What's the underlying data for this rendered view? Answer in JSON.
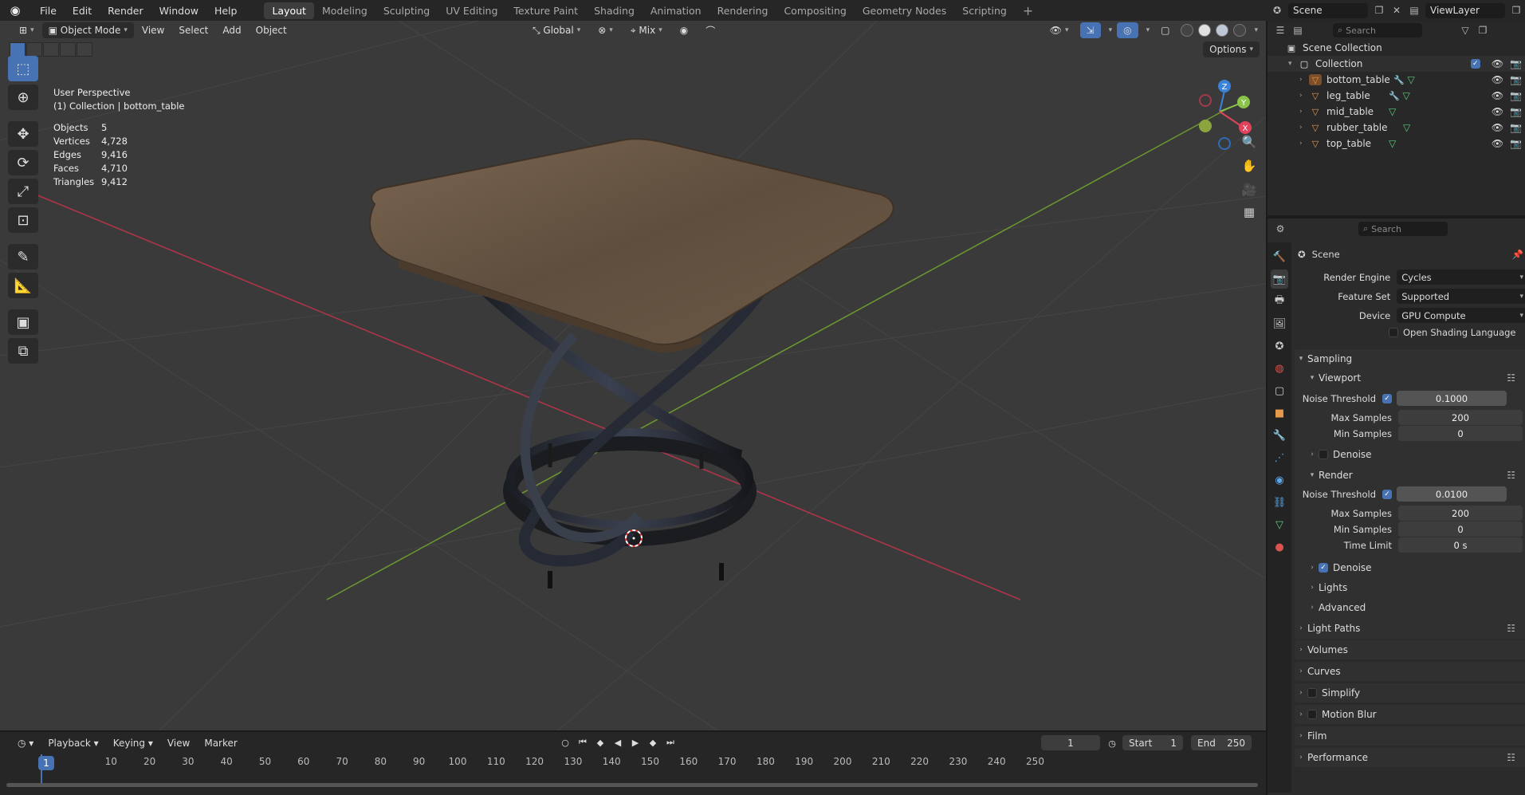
{
  "menubar": {
    "items": [
      "File",
      "Edit",
      "Render",
      "Window",
      "Help"
    ],
    "workspaces": [
      "Layout",
      "Modeling",
      "Sculpting",
      "UV Editing",
      "Texture Paint",
      "Shading",
      "Animation",
      "Rendering",
      "Compositing",
      "Geometry Nodes",
      "Scripting"
    ],
    "active_workspace": "Layout"
  },
  "topright": {
    "scene": "Scene",
    "view_layer": "ViewLayer"
  },
  "viewport": {
    "mode": "Object Mode",
    "menus": [
      "View",
      "Select",
      "Add",
      "Object"
    ],
    "orientation": "Global",
    "proportional": "Mix",
    "options": "Options",
    "overlay": {
      "perspective": "User Perspective",
      "collection": "(1) Collection | bottom_table"
    },
    "stats": [
      {
        "label": "Objects",
        "value": "5"
      },
      {
        "label": "Vertices",
        "value": "4,728"
      },
      {
        "label": "Edges",
        "value": "9,416"
      },
      {
        "label": "Faces",
        "value": "4,710"
      },
      {
        "label": "Triangles",
        "value": "9,412"
      }
    ],
    "gizmo_axes": [
      "X",
      "Y",
      "Z"
    ]
  },
  "timeline": {
    "menus": [
      "Playback",
      "Keying",
      "View",
      "Marker"
    ],
    "current_frame": "1",
    "start_label": "Start",
    "start": "1",
    "end_label": "End",
    "end": "250",
    "ticks": [
      "1",
      "10",
      "20",
      "30",
      "40",
      "50",
      "60",
      "70",
      "80",
      "90",
      "100",
      "110",
      "120",
      "130",
      "140",
      "150",
      "160",
      "170",
      "180",
      "190",
      "200",
      "210",
      "220",
      "230",
      "240",
      "250"
    ]
  },
  "outliner": {
    "search_placeholder": "Search",
    "scene_collection": "Scene Collection",
    "collection": "Collection",
    "objects": [
      "bottom_table",
      "leg_table",
      "mid_table",
      "rubber_table",
      "top_table"
    ]
  },
  "properties": {
    "search_placeholder": "Search",
    "context": "Scene",
    "render_engine_label": "Render Engine",
    "render_engine": "Cycles",
    "feature_set_label": "Feature Set",
    "feature_set": "Supported",
    "device_label": "Device",
    "device": "GPU Compute",
    "osl": "Open Shading Language",
    "sampling": "Sampling",
    "viewport": "Viewport",
    "render": "Render",
    "noise_threshold_label": "Noise Threshold",
    "viewport_noise": "0.1000",
    "render_noise": "0.0100",
    "max_samples_label": "Max Samples",
    "viewport_max": "200",
    "render_max": "200",
    "min_samples_label": "Min Samples",
    "viewport_min": "0",
    "render_min": "0",
    "time_limit_label": "Time Limit",
    "time_limit": "0 s",
    "denoise": "Denoise",
    "lights": "Lights",
    "advanced": "Advanced",
    "panels": [
      "Light Paths",
      "Volumes",
      "Curves",
      "Simplify",
      "Motion Blur",
      "Film",
      "Performance"
    ]
  },
  "colors": {
    "accent": "#4772b3",
    "x_axis": "#e0435b",
    "y_axis": "#8bc34a",
    "z_axis": "#3b82d9"
  }
}
